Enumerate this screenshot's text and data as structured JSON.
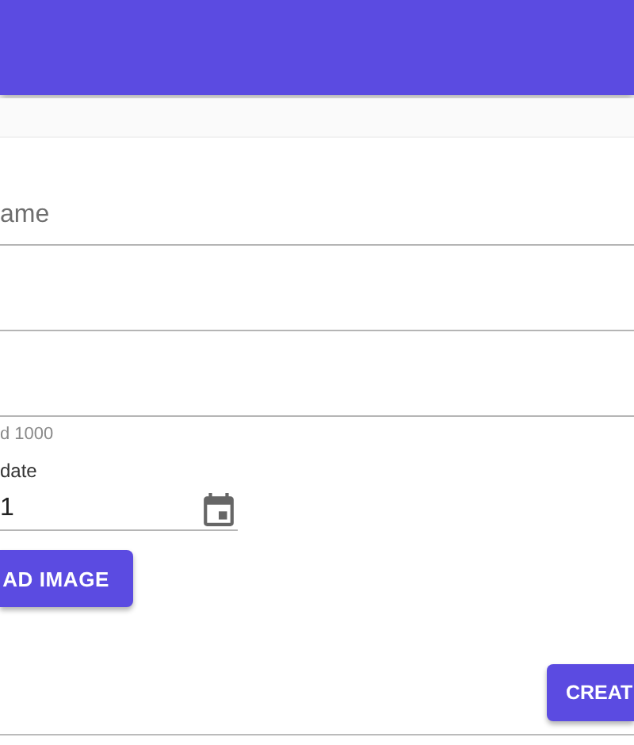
{
  "fields": [
    {
      "kind": "text",
      "placeholder": "ame"
    },
    {
      "kind": "text"
    },
    {
      "kind": "text",
      "helper": "d 1000"
    }
  ],
  "date_field": {
    "label": "date",
    "value": "1"
  },
  "upload_button": {
    "label": "AD IMAGE"
  },
  "create_button": {
    "label": "CREAT"
  }
}
